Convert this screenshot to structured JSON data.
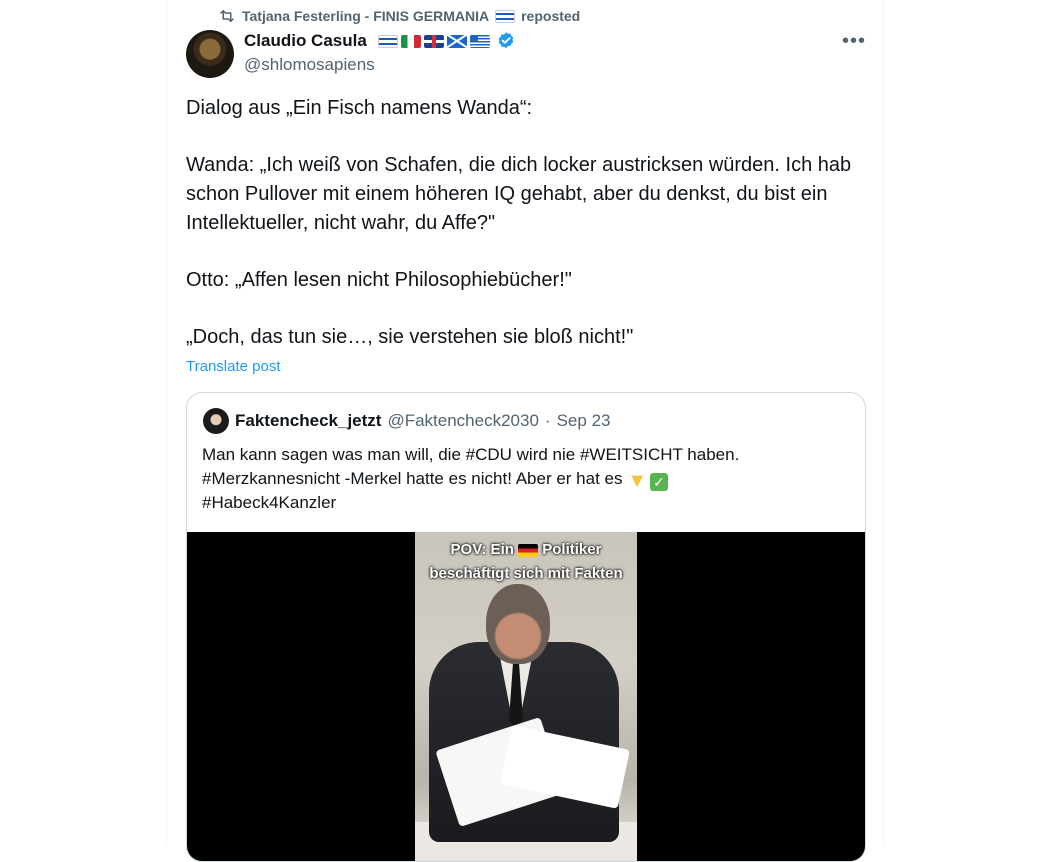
{
  "repost": {
    "label": "Tatjana Festerling - FINIS GERMANIA",
    "suffix": "reposted"
  },
  "author": {
    "name": "Claudio Casula",
    "handle": "@shlomosapiens",
    "flags": [
      "israel-flag",
      "italy-flag",
      "uk-flag",
      "scotland-flag",
      "greece-flag"
    ],
    "verified": true
  },
  "post": {
    "lines": [
      "Dialog aus „Ein Fisch namens Wanda“:",
      "Wanda: „Ich weiß von Schafen, die dich locker austricksen würden. Ich hab schon Pullover mit einem höheren IQ gehabt, aber du denkst, du bist ein Intellektueller, nicht wahr, du Affe?\"",
      "Otto: „Affen lesen nicht Philosophiebücher!\"",
      "„Doch, das tun sie…, sie verstehen sie bloß nicht!\""
    ],
    "translate_label": "Translate post"
  },
  "quote": {
    "name": "Faktencheck_jetzt",
    "handle": "@Faktencheck2030",
    "separator": "·",
    "date": "Sep 23",
    "line1": "Man kann sagen was man will, die #CDU  wird  nie   #WEITSICHT  haben.",
    "line2": "#Merzkannesnicht -Merkel hatte es nicht! Aber er hat es",
    "line3": "#Habeck4Kanzler",
    "video_caption_1_pre": "POV: Ein",
    "video_caption_1_post": "Politiker",
    "video_caption_2": "beschäftigt sich mit Fakten"
  },
  "colors": {
    "text": "#0f1419",
    "secondary": "#536471",
    "link": "#1d9bf0",
    "verified": "#1d9bf0",
    "border": "#cfd9de"
  }
}
